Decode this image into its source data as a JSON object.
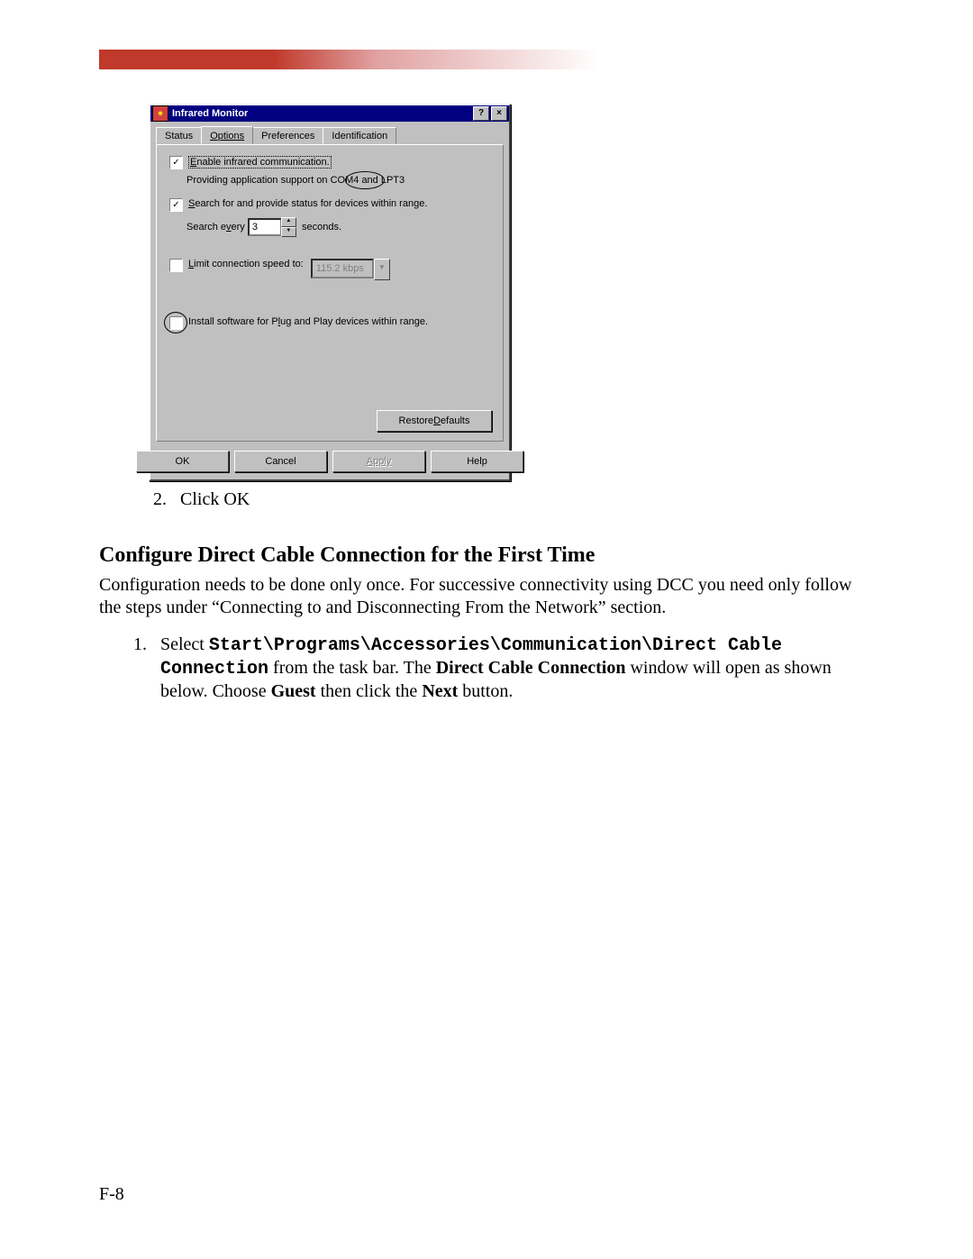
{
  "dialog": {
    "title": "Infrared Monitor",
    "tabs": [
      "Status",
      "Options",
      "Preferences",
      "Identification"
    ],
    "active_tab_index": 1,
    "enable_cb": {
      "checked": true,
      "label_pre": "E",
      "label_rest": "nable infrared communication."
    },
    "enable_sub": "Providing application support on COM4 and LPT3",
    "search_cb": {
      "checked": true,
      "label_pre": "S",
      "label_rest": "earch for and provide status for devices within range."
    },
    "search_every_pre": "Search e",
    "search_every_u": "v",
    "search_every_post": "ery",
    "search_value": "3",
    "search_seconds": "seconds.",
    "limit_cb": {
      "checked": false,
      "label_pre": "L",
      "label_rest": "imit connection speed to:"
    },
    "limit_value": "115.2 kbps",
    "install_cb": {
      "checked": false,
      "label_pre": "Install software for P",
      "label_u": "l",
      "label_post": "ug and Play devices within range."
    },
    "restore_btn_pre": "Restore ",
    "restore_btn_u": "D",
    "restore_btn_post": "efaults",
    "buttons": {
      "ok": "OK",
      "cancel": "Cancel",
      "apply": "Apply",
      "help": "Help"
    }
  },
  "doc": {
    "step2_num": "2.",
    "step2_text": "Click OK",
    "heading": "Configure Direct Cable Connection for the First Time",
    "para": "Configuration needs to be done only once. For successive connectivity using DCC you need only follow the steps under “Connecting to and Disconnecting From the Network” section.",
    "step1_num": "1.",
    "step1_a": "Select ",
    "step1_path": "Start\\Programs\\Accessories\\Communication\\Direct Cable Connection",
    "step1_b": " from the task bar.  The ",
    "step1_bold1": "Direct Cable Connection",
    "step1_c": " window will open as shown below.  Choose ",
    "step1_bold2": "Guest",
    "step1_d": " then click the ",
    "step1_bold3": "Next",
    "step1_e": " button.",
    "page_num": "F-8"
  }
}
